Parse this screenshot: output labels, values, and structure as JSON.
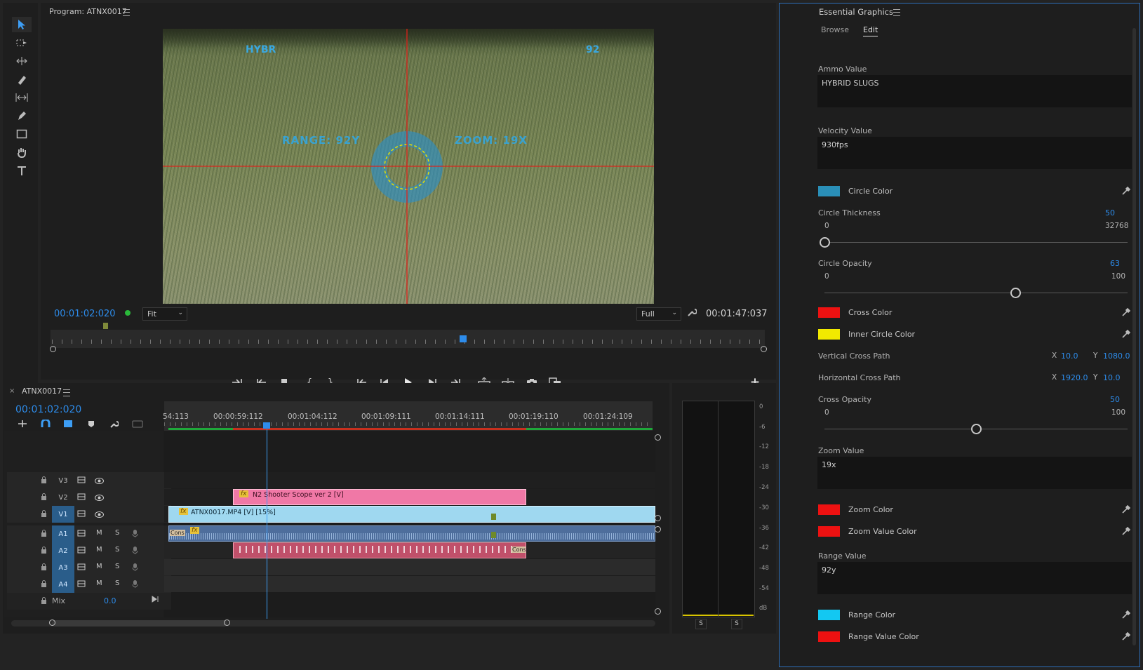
{
  "tools": {
    "items": [
      "selection-tool",
      "track-select-tool",
      "ripple-edit-tool",
      "razor-tool",
      "slip-tool",
      "pen-tool",
      "rectangle-tool",
      "hand-tool",
      "type-tool"
    ]
  },
  "program": {
    "title": "Program: ATNX0017",
    "timecode_current": "00:01:02:020",
    "fit_label": "Fit",
    "quality_label": "Full",
    "timecode_duration": "00:01:47:037",
    "overlay": {
      "top_left": "HYBR",
      "top_right": "92",
      "range_text": "RANGE: 92Y",
      "zoom_text": "ZOOM: 19X"
    }
  },
  "timeline": {
    "sequence_name": "ATNX0017",
    "timecode": "00:01:02:020",
    "ruler_ticks": [
      "54:113",
      "00:00:59:112",
      "00:01:04:112",
      "00:01:09:111",
      "00:01:14:111",
      "00:01:19:110",
      "00:01:24:109"
    ],
    "tracks": [
      {
        "name": "V3",
        "type": "video"
      },
      {
        "name": "V2",
        "type": "video"
      },
      {
        "name": "V1",
        "type": "video"
      },
      {
        "name": "A1",
        "type": "audio"
      },
      {
        "name": "A2",
        "type": "audio"
      },
      {
        "name": "A3",
        "type": "audio"
      },
      {
        "name": "A4",
        "type": "audio"
      }
    ],
    "mute_label": "M",
    "solo_label": "S",
    "mix_label": "Mix",
    "mix_value": "0.0",
    "clips": {
      "v2_label": "N2 Shooter Scope ver 2 [V]",
      "v1_label": "ATNX0017.MP4 [V] [15%]",
      "a1_tag": "Cons",
      "a2_tag": "Cons",
      "fx_label": "fx"
    }
  },
  "audio_meter": {
    "scale": [
      "0",
      "-6",
      "-12",
      "-18",
      "-24",
      "-30",
      "-36",
      "-42",
      "-48",
      "-54",
      "dB"
    ],
    "solo_left": "S",
    "solo_right": "S"
  },
  "essential_graphics": {
    "title": "Essential Graphics",
    "tabs": [
      "Browse",
      "Edit"
    ],
    "ammo_label": "Ammo Value",
    "ammo_value": "HYBRID SLUGS",
    "velocity_label": "Velocity Value",
    "velocity_value": "930fps",
    "circle_color_label": "Circle Color",
    "circle_color": "#2a8fb8",
    "circle_thickness_label": "Circle Thickness",
    "circle_thickness_value": "50",
    "circle_thickness_min": "0",
    "circle_thickness_max": "32768",
    "circle_thickness_fraction": 0.0015,
    "circle_opacity_label": "Circle Opacity",
    "circle_opacity_value": "63",
    "circle_opacity_min": "0",
    "circle_opacity_max": "100",
    "circle_opacity_fraction": 0.63,
    "cross_color_label": "Cross Color",
    "cross_color": "#ee1111",
    "inner_circle_color_label": "Inner Circle Color",
    "inner_circle_color": "#f2ea00",
    "vertical_cross_label": "Vertical Cross Path",
    "vertical_cross_x": "10.0",
    "vertical_cross_y": "1080.0",
    "horizontal_cross_label": "Horizontal Cross Path",
    "horizontal_cross_x": "1920.0",
    "horizontal_cross_y": "10.0",
    "x_label": "X",
    "y_label": "Y",
    "cross_opacity_label": "Cross Opacity",
    "cross_opacity_value": "50",
    "cross_opacity_min": "0",
    "cross_opacity_max": "100",
    "cross_opacity_fraction": 0.5,
    "zoom_label": "Zoom Value",
    "zoom_value": "19x",
    "zoom_color_label": "Zoom Color",
    "zoom_color": "#ee1111",
    "zoom_value_color_label": "Zoom Value Color",
    "zoom_value_color": "#ee1111",
    "range_label": "Range Value",
    "range_value": "92y",
    "range_color_label": "Range Color",
    "range_color": "#13c8f2",
    "range_value_color_label": "Range Value Color",
    "range_value_color": "#ee1111"
  }
}
